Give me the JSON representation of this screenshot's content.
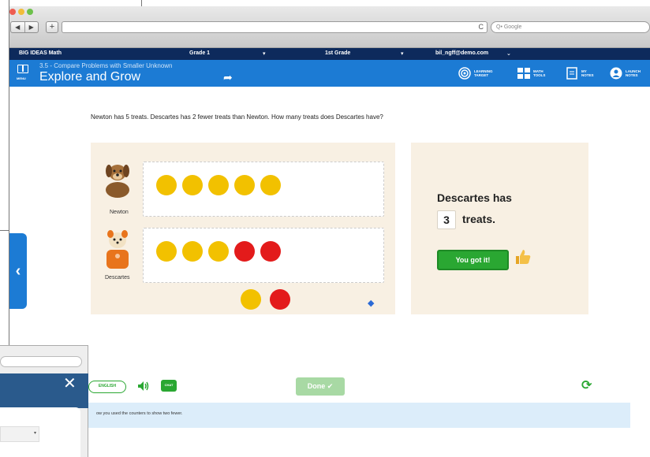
{
  "browser": {
    "search_placeholder": "Q• Google",
    "nav_back": "◀",
    "nav_forward": "▶",
    "new_tab": "+",
    "reload": "C"
  },
  "topnav": {
    "brand": "BIG IDEAS Math",
    "grade": "Grade 1",
    "level": "1st Grade",
    "user": "bil_ngff@demo.com"
  },
  "subnav": {
    "menu_label": "MENU",
    "lesson": "3.5 - Compare Problems with Smaller Unknown",
    "title": "Explore and Grow",
    "tools": [
      {
        "label": "LEARNING TARGET",
        "icon": "target-icon"
      },
      {
        "label": "MATH TOOLS",
        "icon": "grid-tools-icon"
      },
      {
        "label": "MY NOTES",
        "icon": "notes-icon"
      },
      {
        "label": "LAUNCH NOTES",
        "icon": "person-icon"
      }
    ]
  },
  "question": "Newton has 5 treats. Descartes has 2 fewer treats than Newton. How many treats does Descartes have?",
  "work": {
    "characters": [
      {
        "name": "Newton",
        "counters": [
          "yellow",
          "yellow",
          "yellow",
          "yellow",
          "yellow"
        ]
      },
      {
        "name": "Descartes",
        "counters": [
          "yellow",
          "yellow",
          "yellow",
          "red",
          "red"
        ]
      }
    ],
    "tray": [
      "yellow",
      "red"
    ]
  },
  "answer": {
    "line1": "Descartes has",
    "value": "3",
    "line2": "treats.",
    "feedback": "You got it!"
  },
  "footer": {
    "language": "ENGLISH",
    "chat": "CHAT",
    "done": "Done ✔",
    "hint": "ow you used the counters to show two fewer."
  },
  "colors": {
    "nav_dark": "#0d2a5c",
    "nav_blue": "#1c7bd4",
    "green": "#2aa732",
    "counter_yellow": "#f2c100",
    "counter_red": "#e31b1b",
    "panel": "#f8f0e3"
  }
}
